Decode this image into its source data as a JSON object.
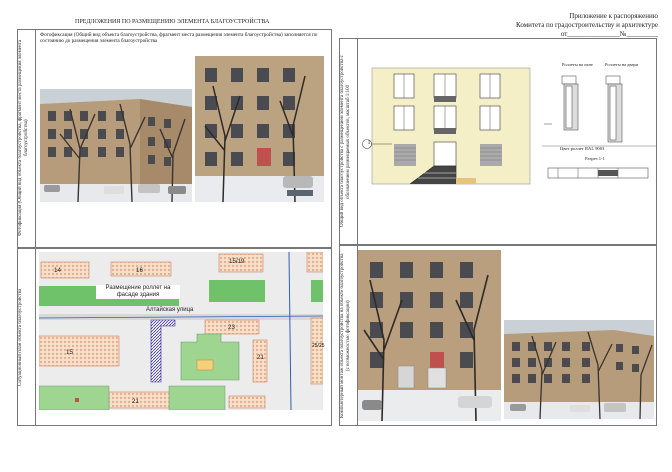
{
  "header": {
    "main_title": "ПРЕДЛОЖЕНИЯ ПО РАЗМЕЩЕНИЮ ЭЛЕМЕНТА БЛАГОУСТРОЙСТВА",
    "appendix_line1": "Приложение к распоряжению",
    "appendix_line2": "Комитета по градостроительству и архитектуре",
    "appendix_line3": "от_______________№_________"
  },
  "panel_photo": {
    "side_label": "Фотофиксация (Общий вид объекта благоустройства, фрагмент места размещения элемента благоустройства)",
    "caption": "Фотофиксация (Общий вид объекта благоустройства, фрагмент места размещения элемента благоустройства) заполняется по состоянию до размещения элемента благоустройства"
  },
  "panel_drawing": {
    "side_label": "Общий вид объекта благоустройства с размещением элемента благоустройства с обозначением размещаемых объектов, масштаб 1:100",
    "callout": "1",
    "label_left": "Роллеты на окне",
    "label_right": "Роллеты на двери",
    "color_note": "Цвет роллет RAL 9003",
    "section_label": "Разрез 1-1"
  },
  "panel_map": {
    "side_label": "Ситуационный план объекта благоустройства",
    "callout": "Размещение роллет на фасаде здания",
    "street": "Алтайская улица",
    "numbers": [
      "14",
      "16",
      "15/19",
      "15",
      "23",
      "21",
      "21",
      "25/25"
    ]
  },
  "panel_photomontage": {
    "side_label": "Компьютерный монтаж объекта благоустройства на объекте благоустройства (с возможностью фотофиксации)"
  }
}
